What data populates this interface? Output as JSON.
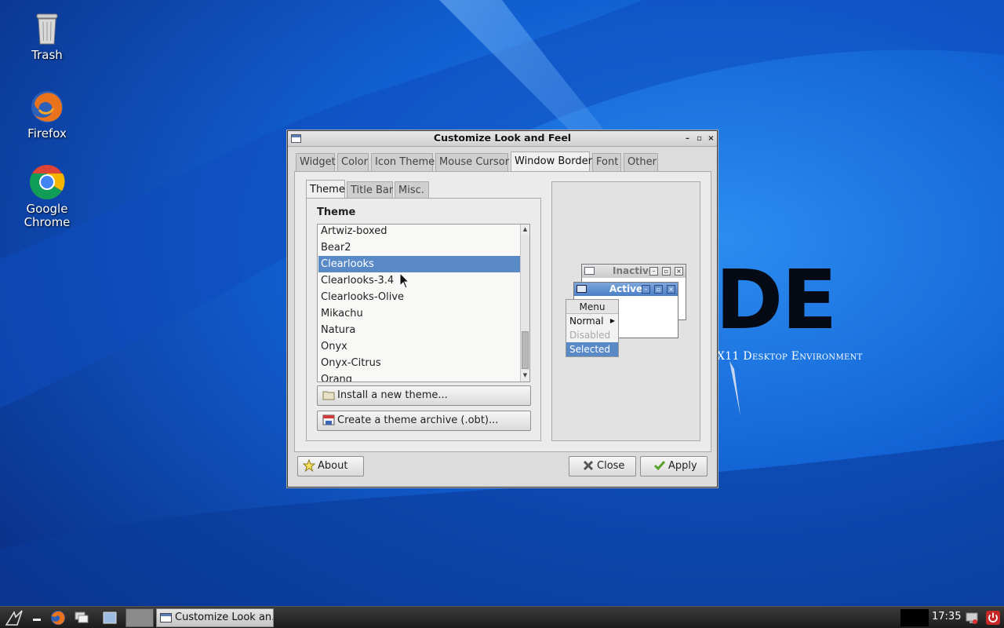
{
  "desktop": {
    "icons": [
      {
        "label": "Trash",
        "icon": "trash-icon"
      },
      {
        "label": "Firefox",
        "icon": "firefox-icon"
      },
      {
        "label": "Google\nChrome",
        "icon": "chrome-icon"
      }
    ],
    "brand": "DE",
    "brand_subtitle": "X11 Desktop Environment"
  },
  "window": {
    "title": "Customize Look and Feel",
    "controls": {
      "minimize": "–",
      "maximize": "▫",
      "close": "×"
    },
    "tabs": [
      "Widget",
      "Color",
      "Icon Theme",
      "Mouse Cursor",
      "Window Border",
      "Font",
      "Other"
    ],
    "active_tab": "Window Border",
    "inner_tabs": [
      "Theme",
      "Title Bar",
      "Misc."
    ],
    "active_inner_tab": "Theme",
    "theme_heading": "Theme",
    "themes": [
      "Artwiz-boxed",
      "Bear2",
      "Clearlooks",
      "Clearlooks-3.4",
      "Clearlooks-Olive",
      "Mikachu",
      "Natura",
      "Onyx",
      "Onyx-Citrus",
      "Orang"
    ],
    "selected_theme": "Clearlooks",
    "install_button": "Install a new theme...",
    "archive_button": "Create a theme archive (.obt)...",
    "preview": {
      "inactive_title": "Inactive",
      "active_title": "Active",
      "menu_title": "Menu",
      "menu_items": [
        "Normal",
        "Disabled",
        "Selected"
      ]
    },
    "about_button": "About",
    "close_button": "Close",
    "apply_button": "Apply"
  },
  "taskbar": {
    "task_label": "Customize Look an...",
    "clock": "17:35"
  },
  "colors": {
    "selection": "#5a89c8",
    "wallpaper": "#0b3f9e"
  }
}
